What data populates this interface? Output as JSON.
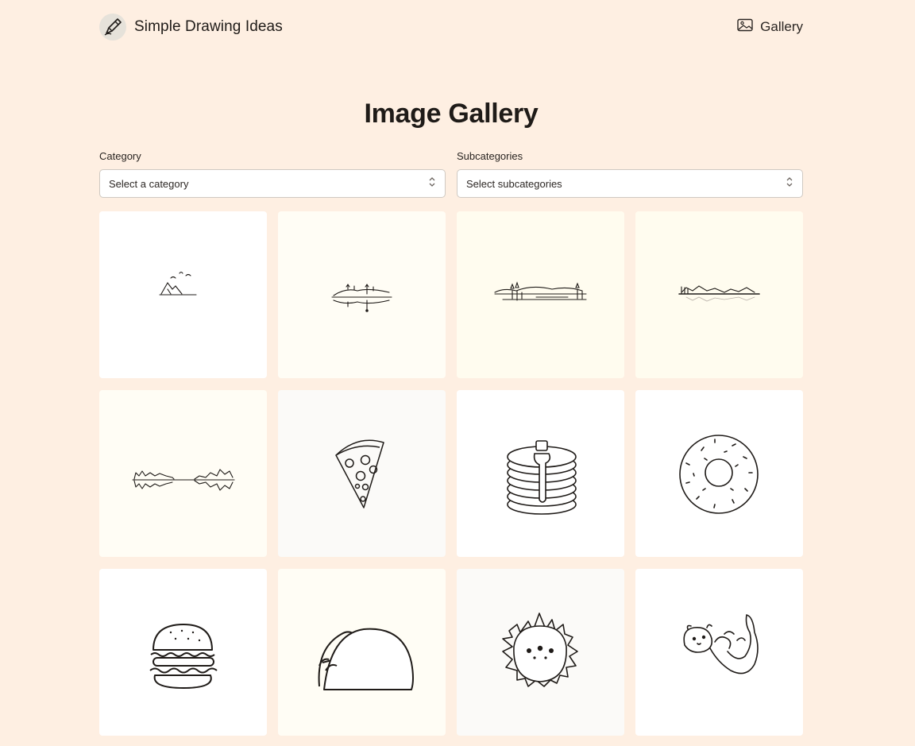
{
  "header": {
    "brand_name": "Simple Drawing Ideas",
    "brand_icon": "pencil-icon",
    "nav_gallery_label": "Gallery",
    "nav_gallery_icon": "image-icon"
  },
  "main": {
    "title": "Image Gallery",
    "filters": {
      "category_label": "Category",
      "category_value": "Select a category",
      "subcategories_label": "Subcategories",
      "subcategories_value": "Select subcategories"
    },
    "gallery": [
      {
        "subject": "mountains-birds"
      },
      {
        "subject": "lake-reflection-trees"
      },
      {
        "subject": "lake-shoreline-trees"
      },
      {
        "subject": "mountain-lake-reflection"
      },
      {
        "subject": "marsh-reflection"
      },
      {
        "subject": "pizza-slice"
      },
      {
        "subject": "pancake-stack"
      },
      {
        "subject": "donut"
      },
      {
        "subject": "burger"
      },
      {
        "subject": "taco"
      },
      {
        "subject": "hedgehog"
      },
      {
        "subject": "otter"
      }
    ]
  }
}
